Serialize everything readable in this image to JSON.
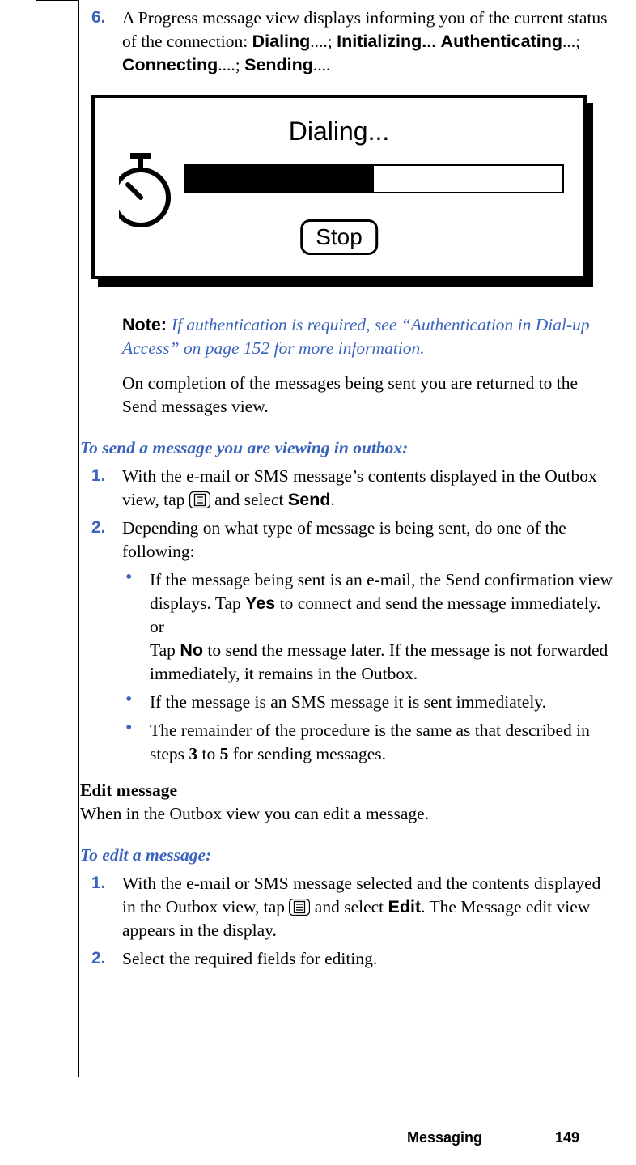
{
  "step6": {
    "num": "6.",
    "text_a": "A Progress message view displays informing you of the current status of the connection: ",
    "status_1": "Dialing",
    "sep_1": "....; ",
    "status_2": "Initializing...",
    "sep_2": " ",
    "status_3": "Authenticating",
    "sep_3": "...; ",
    "status_4": "Connecting",
    "sep_4": "....; ",
    "status_5": "Sending",
    "sep_5": "...."
  },
  "dialog": {
    "title": "Dialing...",
    "progress_percent": 50,
    "stop": "Stop"
  },
  "note": {
    "label": "Note:  ",
    "body": "If authentication is required, see “Authentication in Dial-up Access” on page 152 for more information."
  },
  "after_note": "On completion of the messages being sent you are returned to the Send messages view.",
  "send_heading": "To send a message you are viewing in outbox:",
  "send_steps": {
    "s1": {
      "num": "1.",
      "a": "With the e-mail or SMS message’s contents displayed in the Outbox view, tap ",
      "b": " and select ",
      "bold": "Send",
      "c": "."
    },
    "s2": {
      "num": "2.",
      "text": "Depending on what type of message is being sent, do one of the following:"
    }
  },
  "bullets": {
    "b1": {
      "a": "If the message being sent is an e-mail, the Send confirmation view displays. Tap ",
      "yes": "Yes",
      "b": " to connect and send the message immediately.",
      "or": "or",
      "c": "Tap ",
      "no": "No",
      "d": " to send the message later. If the message is not forwarded immediately, it remains in the Outbox."
    },
    "b2": "If the message is an SMS message it is sent immediately.",
    "b3": {
      "a": "The remainder of the procedure is the same as that described in steps ",
      "s3": "3",
      "to": " to ",
      "s5": "5",
      "b": " for sending messages."
    }
  },
  "edit": {
    "header": "Edit message",
    "body": "When in the Outbox view you can edit a message."
  },
  "edit_heading": "To edit a message:",
  "edit_steps": {
    "s1": {
      "num": "1.",
      "a": "With the e-mail or SMS message selected and the contents displayed in the Outbox view, tap ",
      "b": " and select ",
      "bold": "Edit",
      "c": ". The Message edit view appears in the display."
    },
    "s2": {
      "num": "2.",
      "text": "Select the required fields for editing."
    }
  },
  "footer": {
    "chapter": "Messaging",
    "page": "149"
  }
}
